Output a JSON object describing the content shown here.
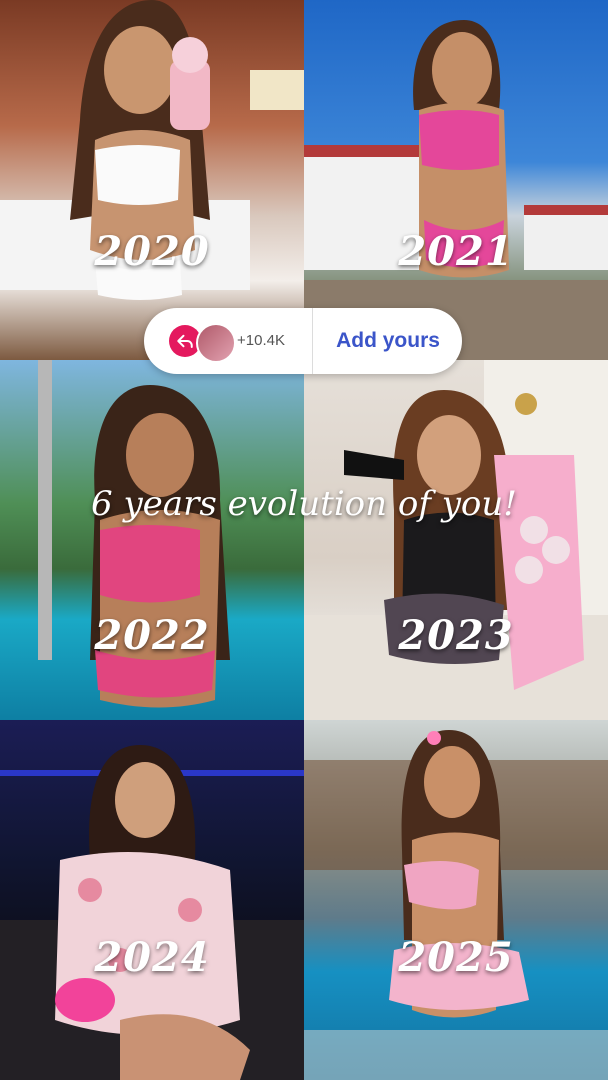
{
  "caption": "6 years evolution of you!",
  "tiles": [
    {
      "year": "2020"
    },
    {
      "year": "2021"
    },
    {
      "year": "2022"
    },
    {
      "year": "2023"
    },
    {
      "year": "2024"
    },
    {
      "year": "2025"
    }
  ],
  "add_yours_sticker": {
    "count": "+10.4K",
    "button_label": "Add yours",
    "share_icon": "share-arrow-icon",
    "accent_color": "#e4195e",
    "button_color": "#3b55c9"
  }
}
